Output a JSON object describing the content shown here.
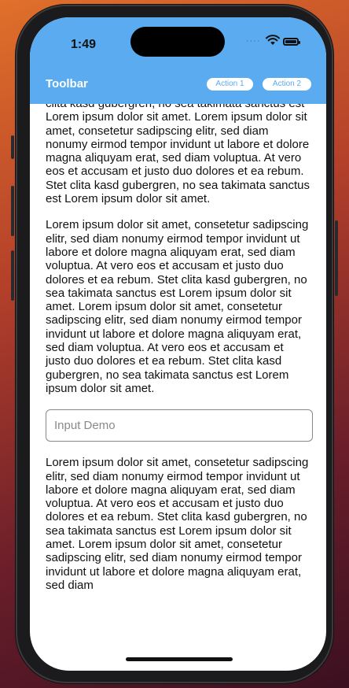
{
  "status": {
    "time": "1:49"
  },
  "toolbar": {
    "title": "Toolbar",
    "action1": "Action 1",
    "action2": "Action 2"
  },
  "content": {
    "paragraph_top": "clita kasd gubergren, no sea takimata sanctus est Lorem ipsum dolor sit amet. Lorem ipsum dolor sit amet, consetetur sadipscing elitr, sed diam nonumy eirmod tempor invidunt ut labore et dolore magna aliquyam erat, sed diam voluptua. At vero eos et accusam et justo duo dolores et ea rebum. Stet clita kasd gubergren, no sea takimata sanctus est Lorem ipsum dolor sit amet.",
    "paragraph_middle": "Lorem ipsum dolor sit amet, consetetur sadipscing elitr, sed diam nonumy eirmod tempor invidunt ut labore et dolore magna aliquyam erat, sed diam voluptua. At vero eos et accusam et justo duo dolores et ea rebum. Stet clita kasd gubergren, no sea takimata sanctus est Lorem ipsum dolor sit amet. Lorem ipsum dolor sit amet, consetetur sadipscing elitr, sed diam nonumy eirmod tempor invidunt ut labore et dolore magna aliquyam erat, sed diam voluptua. At vero eos et accusam et justo duo dolores et ea rebum. Stet clita kasd gubergren, no sea takimata sanctus est Lorem ipsum dolor sit amet.",
    "input_placeholder": "Input Demo",
    "input_value": "",
    "paragraph_bottom": "Lorem ipsum dolor sit amet, consetetur sadipscing elitr, sed diam nonumy eirmod tempor invidunt ut labore et dolore magna aliquyam erat, sed diam voluptua. At vero eos et accusam et justo duo dolores et ea rebum. Stet clita kasd gubergren, no sea takimata sanctus est Lorem ipsum dolor sit amet. Lorem ipsum dolor sit amet, consetetur sadipscing elitr, sed diam nonumy eirmod tempor invidunt ut labore et dolore magna aliquyam erat, sed diam"
  },
  "icons": {
    "wifi": "wifi-icon",
    "battery": "battery-icon",
    "cellular": "cellular-signal-icon"
  },
  "colors": {
    "accent": "#5aabef",
    "text": "#111111"
  }
}
